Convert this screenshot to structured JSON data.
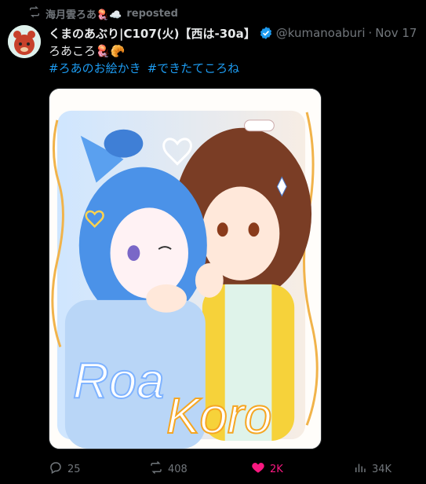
{
  "repost": {
    "user": "海月雲ろあ🪼☁️",
    "label": "reposted"
  },
  "author": {
    "display_name": "くまのあぶり|C107(火)【西は-30a】",
    "handle": "@kumanoaburi",
    "separator": "·",
    "date": "Nov 17"
  },
  "tweet": {
    "text": "ろあころ🪼🥐",
    "hashtags": [
      "#ろあのお絵かき",
      "#できたてころね"
    ]
  },
  "media": {
    "lettering": [
      "Roa",
      "Koro"
    ]
  },
  "actions": {
    "replies": "25",
    "reposts": "408",
    "likes": "2K",
    "views": "34K"
  },
  "colors": {
    "background": "#000000",
    "text": "#e7e9ea",
    "muted": "#71767b",
    "link": "#1d9bf0",
    "like": "#f91880"
  }
}
